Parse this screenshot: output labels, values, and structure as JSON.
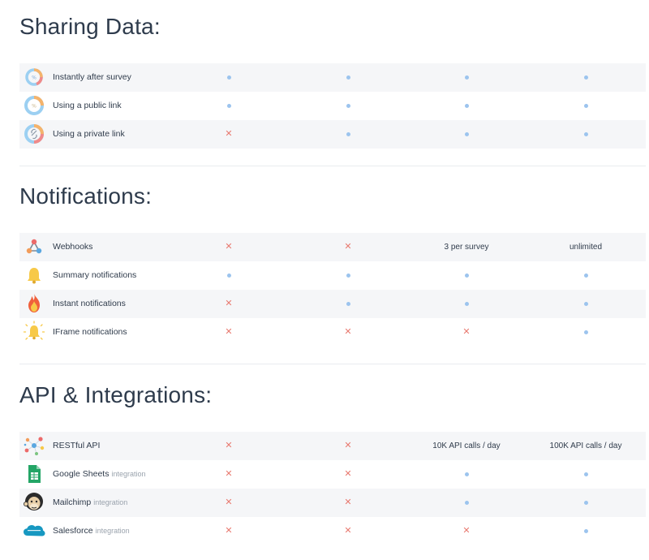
{
  "sections": [
    {
      "title": "Sharing Data:",
      "rows": [
        {
          "label": "Instantly after survey",
          "sub": "",
          "icon": "share-donut-icon",
          "cells": [
            "dot",
            "dot",
            "dot",
            "dot"
          ]
        },
        {
          "label": "Using a public link",
          "sub": "",
          "icon": "public-link-donut-icon",
          "cells": [
            "dot",
            "dot",
            "dot",
            "dot"
          ]
        },
        {
          "label": "Using a private link",
          "sub": "",
          "icon": "private-link-donut-icon",
          "cells": [
            "cross",
            "dot",
            "dot",
            "dot"
          ]
        }
      ]
    },
    {
      "title": "Notifications:",
      "rows": [
        {
          "label": "Webhooks",
          "sub": "",
          "icon": "webhook-icon",
          "cells": [
            "cross",
            "cross",
            "3 per survey",
            "unlimited"
          ]
        },
        {
          "label": "Summary notifications",
          "sub": "",
          "icon": "bell-icon",
          "cells": [
            "dot",
            "dot",
            "dot",
            "dot"
          ]
        },
        {
          "label": "Instant notifications",
          "sub": "",
          "icon": "flame-icon",
          "cells": [
            "cross",
            "dot",
            "dot",
            "dot"
          ]
        },
        {
          "label": "IFrame notifications",
          "sub": "",
          "icon": "ringing-bell-icon",
          "cells": [
            "cross",
            "cross",
            "cross",
            "dot"
          ]
        }
      ]
    },
    {
      "title": "API & Integrations:",
      "rows": [
        {
          "label": "RESTful API",
          "sub": "",
          "icon": "api-network-icon",
          "cells": [
            "cross",
            "cross",
            "10K API calls / day",
            "100K API calls / day"
          ]
        },
        {
          "label": "Google Sheets",
          "sub": "integration",
          "icon": "google-sheets-icon",
          "cells": [
            "cross",
            "cross",
            "dot",
            "dot"
          ]
        },
        {
          "label": "Mailchimp",
          "sub": "integration",
          "icon": "mailchimp-icon",
          "cells": [
            "cross",
            "cross",
            "dot",
            "dot"
          ]
        },
        {
          "label": "Salesforce",
          "sub": "integration",
          "icon": "salesforce-icon",
          "cells": [
            "cross",
            "cross",
            "cross",
            "dot"
          ]
        }
      ]
    }
  ],
  "colors": {
    "dot": "#9cc4ee",
    "cross": "#e8786e",
    "row_shade": "#f5f6f8",
    "title": "#2e3b4c"
  }
}
